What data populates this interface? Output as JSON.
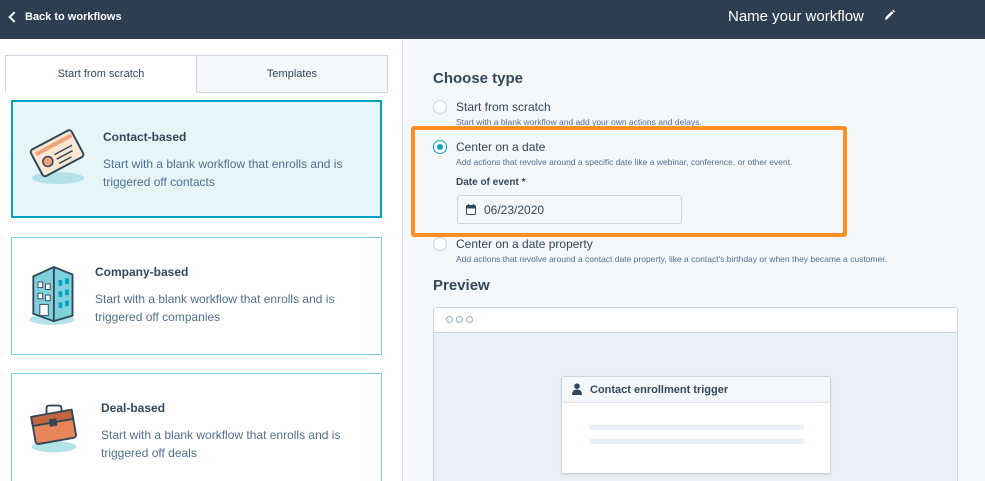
{
  "topbar": {
    "back_label": "Back to workflows",
    "workflow_name": "Name your workflow"
  },
  "tabs": {
    "scratch": "Start from scratch",
    "templates": "Templates"
  },
  "cards": [
    {
      "title": "Contact-based",
      "desc": "Start with a blank workflow that enrolls and is triggered off contacts"
    },
    {
      "title": "Company-based",
      "desc": "Start with a blank workflow that enrolls and is triggered off companies"
    },
    {
      "title": "Deal-based",
      "desc": "Start with a blank workflow that enrolls and is triggered off deals"
    }
  ],
  "choose": {
    "heading": "Choose type",
    "options": [
      {
        "label": "Start from scratch",
        "help": "Start with a blank workflow and add your own actions and delays."
      },
      {
        "label": "Center on a date",
        "help": "Add actions that revolve around a specific date like a webinar, conference, or other event."
      },
      {
        "label": "Center on a date property",
        "help": "Add actions that revolve around a contact date property, like a contact's birthday or when they became a customer."
      }
    ],
    "selected": "Center on a date",
    "date_label": "Date of event *",
    "date_value": "06/23/2020"
  },
  "preview": {
    "heading": "Preview",
    "trigger_title": "Contact enrollment trigger"
  },
  "colors": {
    "topbar": "#2d3e50",
    "accent": "#00a4bd",
    "highlight": "#ff8f1f",
    "panel_bg": "#f5f8fa"
  }
}
